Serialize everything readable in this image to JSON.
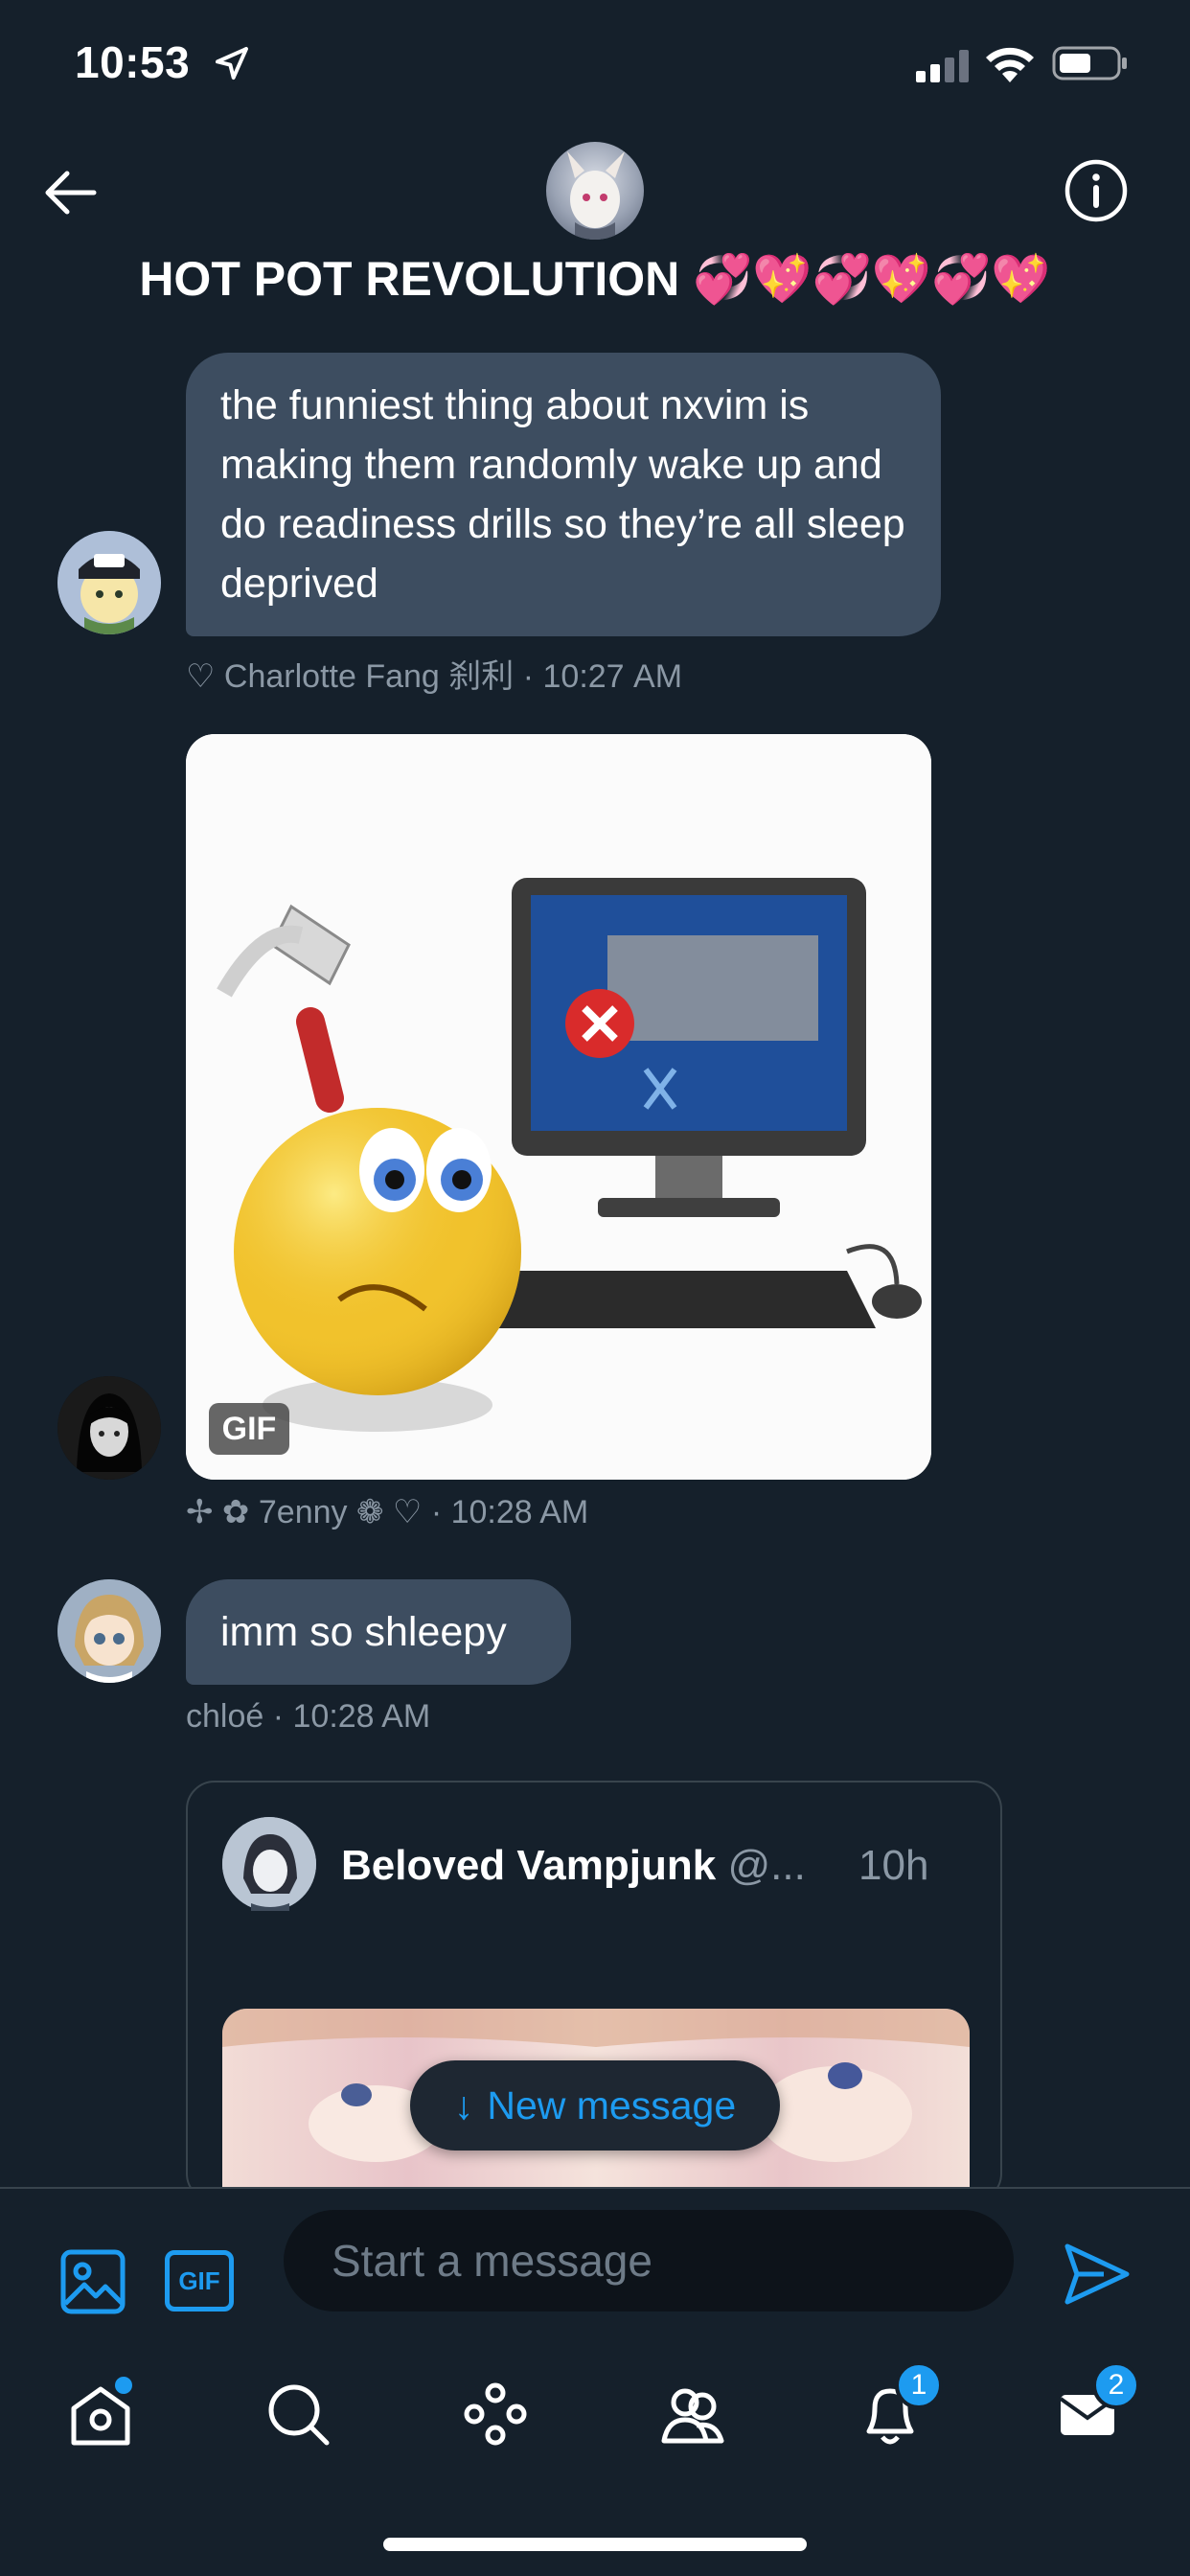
{
  "status_bar": {
    "time": "10:53"
  },
  "header": {
    "title": "HOT POT REVOLUTION 💞💖💞💖💞💖",
    "back_icon": "arrow-left-icon",
    "info_icon": "info-icon"
  },
  "messages": [
    {
      "type": "text",
      "text": "the funniest thing about nxvim is making them randomly wake up and do readiness drills so they’re all sleep deprived",
      "sender": "♡ Charlotte Fang 刹利",
      "time": "· 10:27 AM"
    },
    {
      "type": "gif",
      "badge": "GIF",
      "sender": "✢ ✿ 7enny ❁ ♡",
      "time": "· 10:28 AM"
    },
    {
      "type": "text",
      "text": "imm so shleepy",
      "sender": "chloé",
      "time": "· 10:28 AM"
    },
    {
      "type": "tweet",
      "author_name": "Beloved Vampjunk",
      "author_handle": "@...",
      "time": "10h"
    }
  ],
  "new_message_pill": {
    "arrow": "↓",
    "label": "New message"
  },
  "composer": {
    "placeholder": "Start a message",
    "gif_label": "GIF"
  },
  "tabbar": {
    "items": [
      {
        "name": "home",
        "icon": "home-icon",
        "dot": true
      },
      {
        "name": "search",
        "icon": "search-icon"
      },
      {
        "name": "spaces",
        "icon": "spaces-icon"
      },
      {
        "name": "communities",
        "icon": "communities-icon"
      },
      {
        "name": "notifications",
        "icon": "bell-icon",
        "badge": "1"
      },
      {
        "name": "messages",
        "icon": "envelope-icon",
        "badge": "2"
      }
    ]
  },
  "colors": {
    "background": "#15202b",
    "bubble": "#3d4d60",
    "accent": "#1d9bf0",
    "muted_text": "#8b98a5"
  }
}
